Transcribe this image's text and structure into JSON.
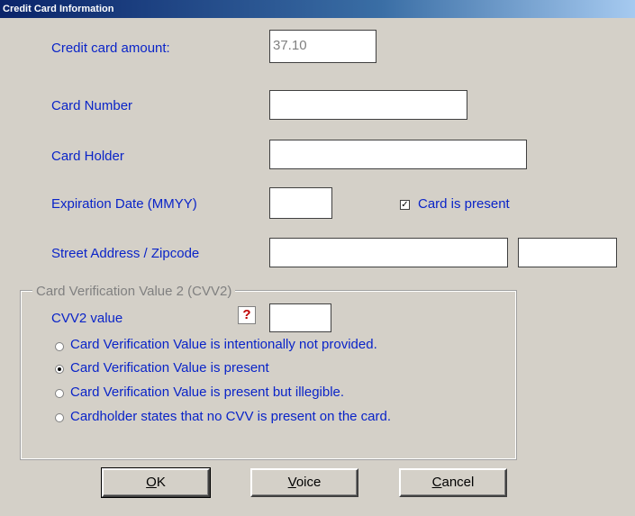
{
  "window": {
    "title": "Credit Card Information"
  },
  "fields": {
    "amount_label": "Credit card amount:",
    "amount_value": "37.10",
    "card_number_label": "Card Number",
    "card_number_value": "",
    "card_holder_label": "Card Holder",
    "card_holder_value": "",
    "expiration_label": "Expiration Date (MMYY)",
    "expiration_value": "",
    "card_present_label": "Card is present",
    "card_present_checked": true,
    "address_label": "Street Address / Zipcode",
    "street_value": "",
    "zip_value": ""
  },
  "cvv": {
    "group_title": "Card Verification Value 2 (CVV2)",
    "value_label": "CVV2 value",
    "help_icon": "?",
    "value": "",
    "options": [
      {
        "label": "Card Verification Value is intentionally not provided.",
        "selected": false
      },
      {
        "label": "Card Verification Value is present",
        "selected": true
      },
      {
        "label": "Card Verification Value is present but illegible.",
        "selected": false
      },
      {
        "label": "Cardholder states that no CVV is present on the card.",
        "selected": false
      }
    ]
  },
  "buttons": {
    "ok": {
      "accel": "O",
      "rest": "K"
    },
    "voice": {
      "accel": "V",
      "rest": "oice"
    },
    "cancel": {
      "accel": "C",
      "rest": "ancel"
    }
  },
  "colors": {
    "label": "#0a24c8",
    "face": "#d4d0c8",
    "title_start": "#0a246a",
    "title_end": "#a6caf0"
  }
}
